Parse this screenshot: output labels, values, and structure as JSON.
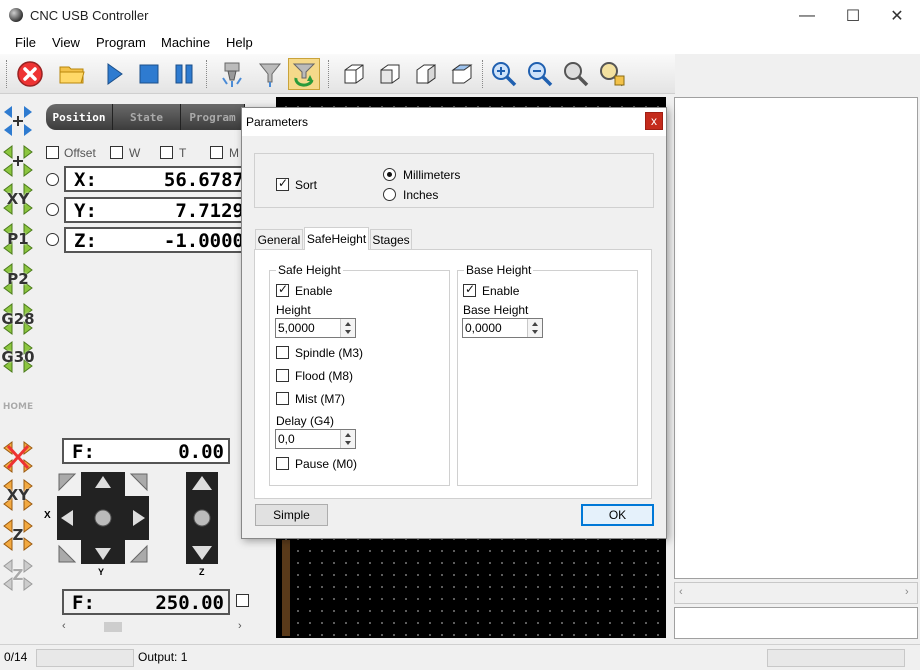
{
  "window": {
    "title": "CNC USB Controller",
    "minimize": "—",
    "maximize": "☐",
    "close": "✕"
  },
  "menu": [
    "File",
    "View",
    "Program",
    "Machine",
    "Help"
  ],
  "left_labels": [
    "XY",
    "P1",
    "P2",
    "G28",
    "G30",
    "HOME",
    "XY",
    "Z",
    "Z"
  ],
  "position_panel": {
    "tabs": [
      "Position",
      "State",
      "Program"
    ],
    "checkboxes": [
      "Offset",
      "W",
      "T",
      "M"
    ],
    "coords": [
      {
        "label": "X:",
        "value": "56.6787"
      },
      {
        "label": "Y:",
        "value": "7.7129"
      },
      {
        "label": "Z:",
        "value": "-1.0000"
      }
    ],
    "feed_f": {
      "label": "F:",
      "value": "0.00"
    },
    "jog_labels": {
      "x": "X",
      "y": "Y",
      "z": "Z"
    },
    "speed": {
      "label": "F:",
      "value": "250.00"
    }
  },
  "status": {
    "count": "0/14",
    "output": "Output: 1"
  },
  "dialog": {
    "title": "Parameters",
    "close": "x",
    "sort_label": "Sort",
    "units": [
      {
        "label": "Millimeters",
        "selected": true
      },
      {
        "label": "Inches",
        "selected": false
      }
    ],
    "tabs": [
      "General",
      "SafeHeight",
      "Stages"
    ],
    "safe_height": {
      "title": "Safe Height",
      "enable": "Enable",
      "height_label": "Height",
      "height_value": "5,0000",
      "spindle": "Spindle (M3)",
      "flood": "Flood (M8)",
      "mist": "Mist (M7)",
      "delay_label": "Delay (G4)",
      "delay_value": "0,0",
      "pause": "Pause (M0)"
    },
    "base_height": {
      "title": "Base Height",
      "enable": "Enable",
      "height_label": "Base Height",
      "height_value": "0,0000"
    },
    "simple_button": "Simple",
    "ok_button": "OK"
  }
}
